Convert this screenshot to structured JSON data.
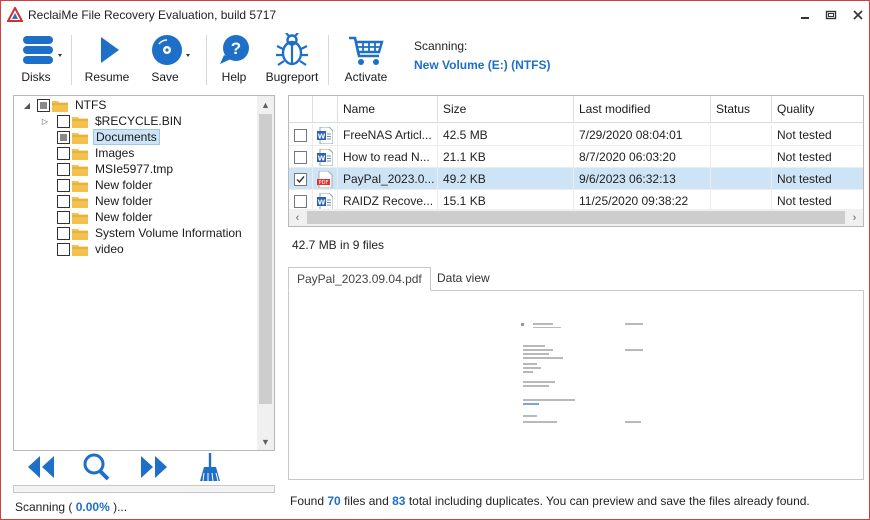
{
  "window": {
    "title": "ReclaiMe File Recovery Evaluation, build 5717"
  },
  "toolbar": {
    "disks": "Disks",
    "resume": "Resume",
    "save": "Save",
    "help": "Help",
    "bugreport": "Bugreport",
    "activate": "Activate",
    "scanning_label": "Scanning:",
    "scanning_volume": "New Volume (E:) (NTFS)"
  },
  "tree": {
    "root": "NTFS",
    "items": [
      {
        "label": "$RECYCLE.BIN",
        "state": "unchecked",
        "expandable": true
      },
      {
        "label": "Documents",
        "state": "partial",
        "selected": true
      },
      {
        "label": "Images",
        "state": "unchecked"
      },
      {
        "label": "MSIe5977.tmp",
        "state": "unchecked"
      },
      {
        "label": "New folder",
        "state": "unchecked"
      },
      {
        "label": "New folder",
        "state": "unchecked"
      },
      {
        "label": "New folder",
        "state": "unchecked"
      },
      {
        "label": "System Volume Information",
        "state": "unchecked"
      },
      {
        "label": "video",
        "state": "unchecked"
      }
    ]
  },
  "table": {
    "columns": [
      "Name",
      "Size",
      "Last modified",
      "Status",
      "Quality"
    ],
    "rows": [
      {
        "name": "FreeNAS Articl...",
        "size": "42.5 MB",
        "modified": "7/29/2020 08:04:01",
        "status": "",
        "quality": "Not tested",
        "type": "word",
        "checked": false
      },
      {
        "name": "How to read N...",
        "size": "21.1 KB",
        "modified": "8/7/2020 06:03:20",
        "status": "",
        "quality": "Not tested",
        "type": "word",
        "checked": false
      },
      {
        "name": "PayPal_2023.0...",
        "size": "49.2 KB",
        "modified": "9/6/2023 06:32:13",
        "status": "",
        "quality": "Not tested",
        "type": "pdf",
        "checked": true
      },
      {
        "name": "RAIDZ Recove...",
        "size": "15.1 KB",
        "modified": "11/25/2020 09:38:22",
        "status": "",
        "quality": "Not tested",
        "type": "word",
        "checked": false
      }
    ]
  },
  "summary": "42.7 MB in 9 files",
  "preview": {
    "tabs": [
      "PayPal_2023.09.04.pdf",
      "Data view"
    ],
    "active_tab": 0
  },
  "status": {
    "scan_prefix": "Scanning (",
    "scan_percent": "0.00%",
    "scan_suffix": ")...",
    "progress": 0.0,
    "found_prefix": "Found",
    "found_count": "70",
    "found_middle": "files and",
    "total_count": "83",
    "found_suffix": "total including duplicates. You can preview and save the files already found."
  },
  "colors": {
    "accent": "#1e6fc8",
    "selection": "#cde4f7",
    "folder": "#f2c14e"
  },
  "icons": {
    "disks": "disks-icon",
    "resume": "play-icon",
    "save": "disc-icon",
    "help": "help-bubble-icon",
    "bugreport": "bug-icon",
    "activate": "cart-icon",
    "nav": [
      "rewind-icon",
      "search-icon",
      "fast-forward-icon",
      "broom-icon"
    ]
  }
}
